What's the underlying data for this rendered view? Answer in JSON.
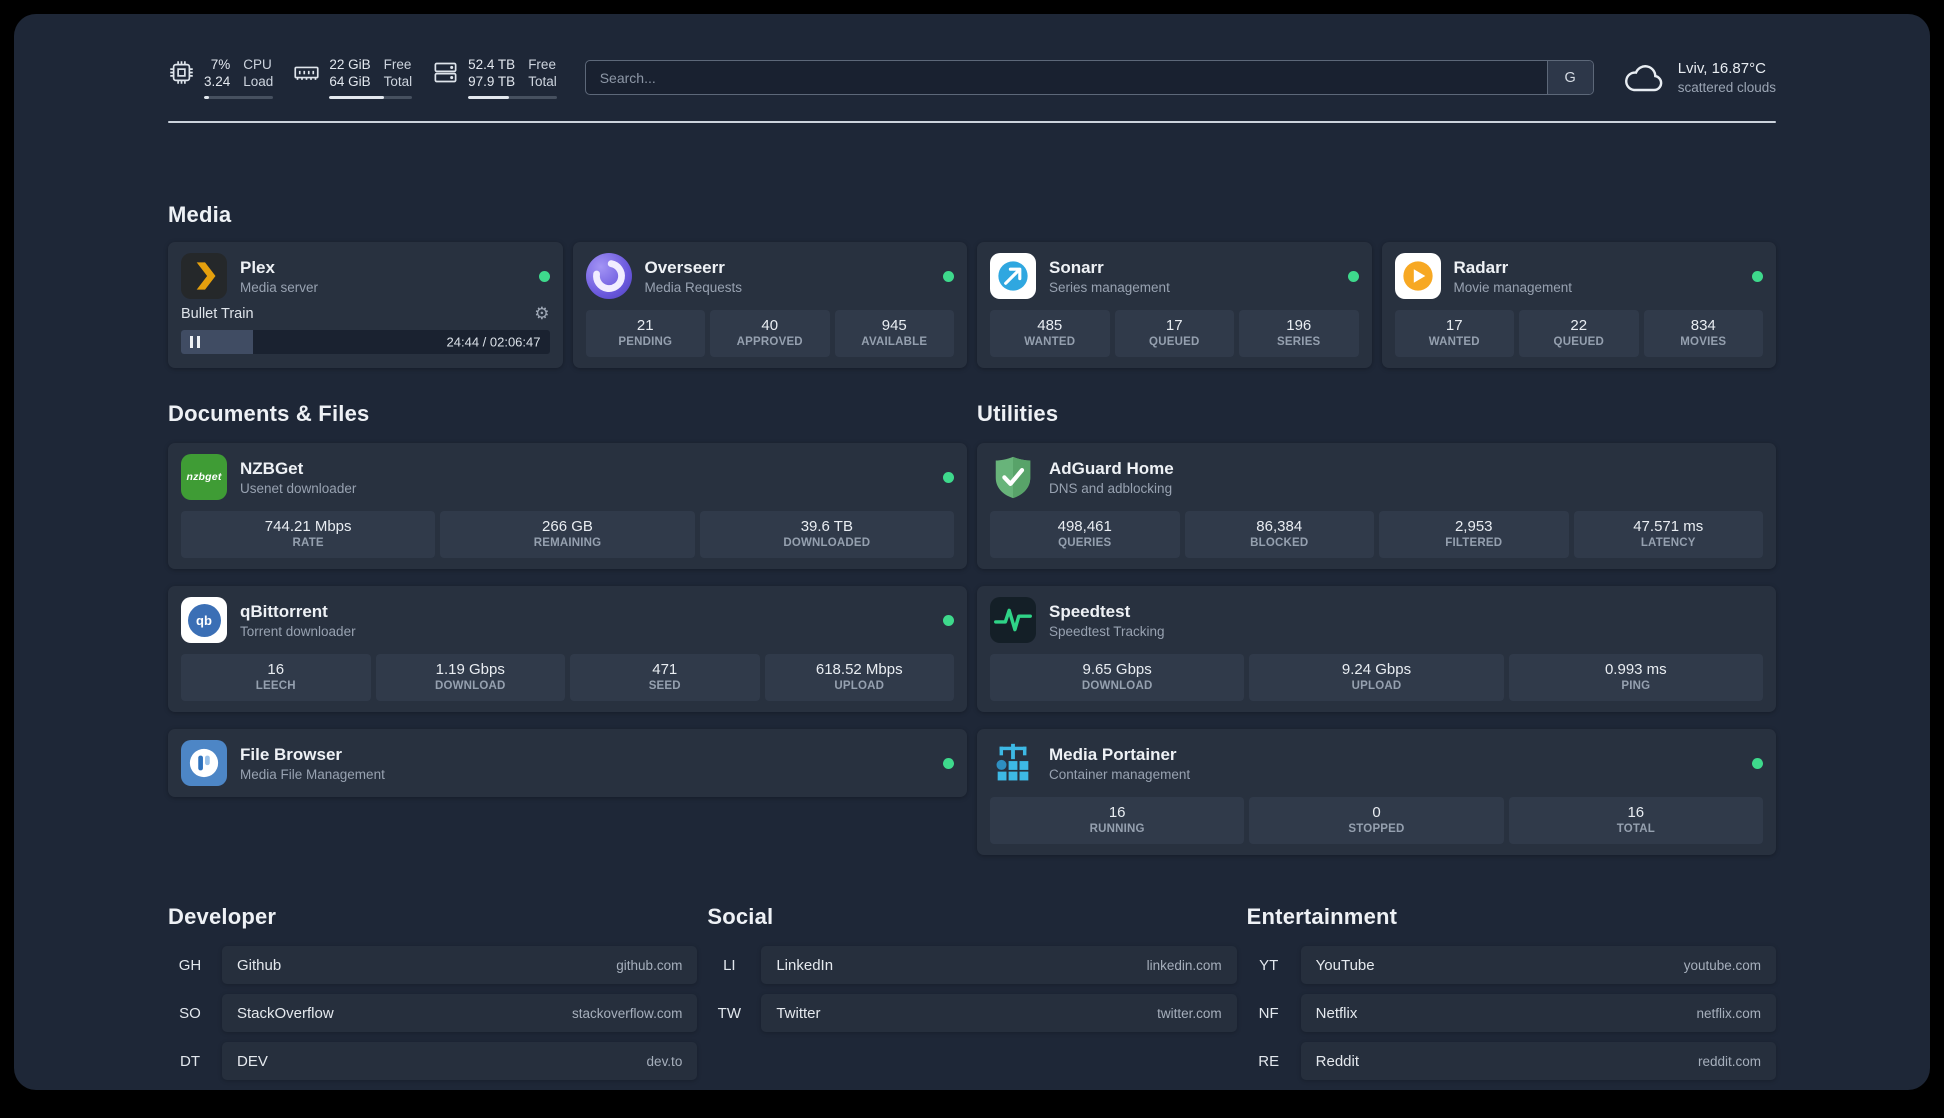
{
  "colors": {
    "status_online": "#3ed98c",
    "plex_accent": "#e5a00d",
    "adguard_green": "#68b47a",
    "speedtest_green": "#2fd387",
    "portainer_blue": "#3db9e5"
  },
  "topbar": {
    "cpu": {
      "percent": "7%",
      "load": "3.24",
      "label_top": "CPU",
      "label_bottom": "Load",
      "bar": "7%"
    },
    "memory": {
      "free": "22 GiB",
      "total": "64 GiB",
      "label_top": "Free",
      "label_bottom": "Total",
      "bar": "66%"
    },
    "disk": {
      "free": "52.4 TB",
      "total": "97.9 TB",
      "label_top": "Free",
      "label_bottom": "Total",
      "bar": "46%"
    },
    "search": {
      "placeholder": "Search...",
      "provider": "G"
    },
    "weather": {
      "location": "Lviv, 16.87°C",
      "condition": "scattered clouds"
    }
  },
  "sections": {
    "media": "Media",
    "documents": "Documents & Files",
    "utilities": "Utilities",
    "developer": "Developer",
    "social": "Social",
    "entertainment": "Entertainment"
  },
  "services": {
    "plex": {
      "name": "Plex",
      "description": "Media server",
      "now_playing": "Bullet Train",
      "time": "24:44 / 02:06:47",
      "progress": "19.5%"
    },
    "overseerr": {
      "name": "Overseerr",
      "description": "Media Requests",
      "stats": [
        {
          "value": "21",
          "label": "PENDING"
        },
        {
          "value": "40",
          "label": "APPROVED"
        },
        {
          "value": "945",
          "label": "AVAILABLE"
        }
      ]
    },
    "sonarr": {
      "name": "Sonarr",
      "description": "Series management",
      "stats": [
        {
          "value": "485",
          "label": "WANTED"
        },
        {
          "value": "17",
          "label": "QUEUED"
        },
        {
          "value": "196",
          "label": "SERIES"
        }
      ]
    },
    "radarr": {
      "name": "Radarr",
      "description": "Movie management",
      "stats": [
        {
          "value": "17",
          "label": "WANTED"
        },
        {
          "value": "22",
          "label": "QUEUED"
        },
        {
          "value": "834",
          "label": "MOVIES"
        }
      ]
    },
    "nzbget": {
      "name": "NZBGet",
      "description": "Usenet downloader",
      "icon_text": "nzbget",
      "stats": [
        {
          "value": "744.21 Mbps",
          "label": "RATE"
        },
        {
          "value": "266 GB",
          "label": "REMAINING"
        },
        {
          "value": "39.6 TB",
          "label": "DOWNLOADED"
        }
      ]
    },
    "qbittorrent": {
      "name": "qBittorrent",
      "description": "Torrent downloader",
      "icon_text": "qb",
      "stats": [
        {
          "value": "16",
          "label": "LEECH"
        },
        {
          "value": "1.19 Gbps",
          "label": "DOWNLOAD"
        },
        {
          "value": "471",
          "label": "SEED"
        },
        {
          "value": "618.52 Mbps",
          "label": "UPLOAD"
        }
      ]
    },
    "filebrowser": {
      "name": "File Browser",
      "description": "Media File Management"
    },
    "adguard": {
      "name": "AdGuard Home",
      "description": "DNS and adblocking",
      "stats": [
        {
          "value": "498,461",
          "label": "QUERIES"
        },
        {
          "value": "86,384",
          "label": "BLOCKED"
        },
        {
          "value": "2,953",
          "label": "FILTERED"
        },
        {
          "value": "47.571 ms",
          "label": "LATENCY"
        }
      ]
    },
    "speedtest": {
      "name": "Speedtest",
      "description": "Speedtest Tracking",
      "stats": [
        {
          "value": "9.65 Gbps",
          "label": "DOWNLOAD"
        },
        {
          "value": "9.24 Gbps",
          "label": "UPLOAD"
        },
        {
          "value": "0.993 ms",
          "label": "PING"
        }
      ]
    },
    "portainer": {
      "name": "Media Portainer",
      "description": "Container management",
      "stats": [
        {
          "value": "16",
          "label": "RUNNING"
        },
        {
          "value": "0",
          "label": "STOPPED"
        },
        {
          "value": "16",
          "label": "TOTAL"
        }
      ]
    }
  },
  "bookmarks": {
    "developer": [
      {
        "abbr": "GH",
        "name": "Github",
        "url": "github.com"
      },
      {
        "abbr": "SO",
        "name": "StackOverflow",
        "url": "stackoverflow.com"
      },
      {
        "abbr": "DT",
        "name": "DEV",
        "url": "dev.to"
      }
    ],
    "social": [
      {
        "abbr": "LI",
        "name": "LinkedIn",
        "url": "linkedin.com"
      },
      {
        "abbr": "TW",
        "name": "Twitter",
        "url": "twitter.com"
      }
    ],
    "entertainment": [
      {
        "abbr": "YT",
        "name": "YouTube",
        "url": "youtube.com"
      },
      {
        "abbr": "NF",
        "name": "Netflix",
        "url": "netflix.com"
      },
      {
        "abbr": "RE",
        "name": "Reddit",
        "url": "reddit.com"
      }
    ]
  },
  "icons": {
    "settings": "⚙"
  }
}
